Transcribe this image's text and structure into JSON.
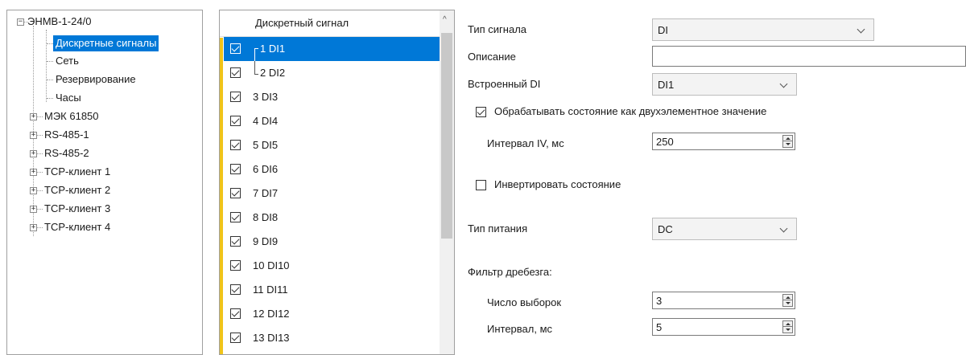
{
  "tree": {
    "root": "ЭНМВ-1-24/0",
    "root_toggle": "−",
    "children": [
      "Дискретные сигналы",
      "Сеть",
      "Резервирование",
      "Часы"
    ],
    "collapsed": [
      "МЭК 61850",
      "RS-485-1",
      "RS-485-2",
      "TCP-клиент 1",
      "TCP-клиент 2",
      "TCP-клиент 3",
      "TCP-клиент 4"
    ],
    "collapsed_toggle": "+"
  },
  "signals": {
    "header": "Дискретный сигнал",
    "scroll_up_icon": "^",
    "rows": [
      "1 DI1",
      "2 DI2",
      "3 DI3",
      "4 DI4",
      "5 DI5",
      "6 DI6",
      "7 DI7",
      "8 DI8",
      "9 DI9",
      "10 DI10",
      "11 DI11",
      "12 DI12",
      "13 DI13"
    ],
    "selected_index": 0,
    "checked": true,
    "accent_color": "#f0c419",
    "selection_color": "#0078d7"
  },
  "props": {
    "signal_type": {
      "label": "Тип сигнала",
      "value": "DI"
    },
    "description": {
      "label": "Описание",
      "value": ""
    },
    "builtin_di": {
      "label": "Встроенный DI",
      "value": "DI1"
    },
    "two_element": {
      "label": "Обрабатывать состояние как двухэлементное значение",
      "checked": true
    },
    "interval_iv": {
      "label": "Интервал IV, мс",
      "value": "250"
    },
    "invert": {
      "label": "Инвертировать состояние",
      "checked": false
    },
    "power_type": {
      "label": "Тип питания",
      "value": "DC"
    },
    "debounce": {
      "label": "Фильтр дребезга:",
      "samples": {
        "label": "Число выборок",
        "value": "3"
      },
      "interval": {
        "label": "Интервал, мс",
        "value": "5"
      }
    }
  }
}
